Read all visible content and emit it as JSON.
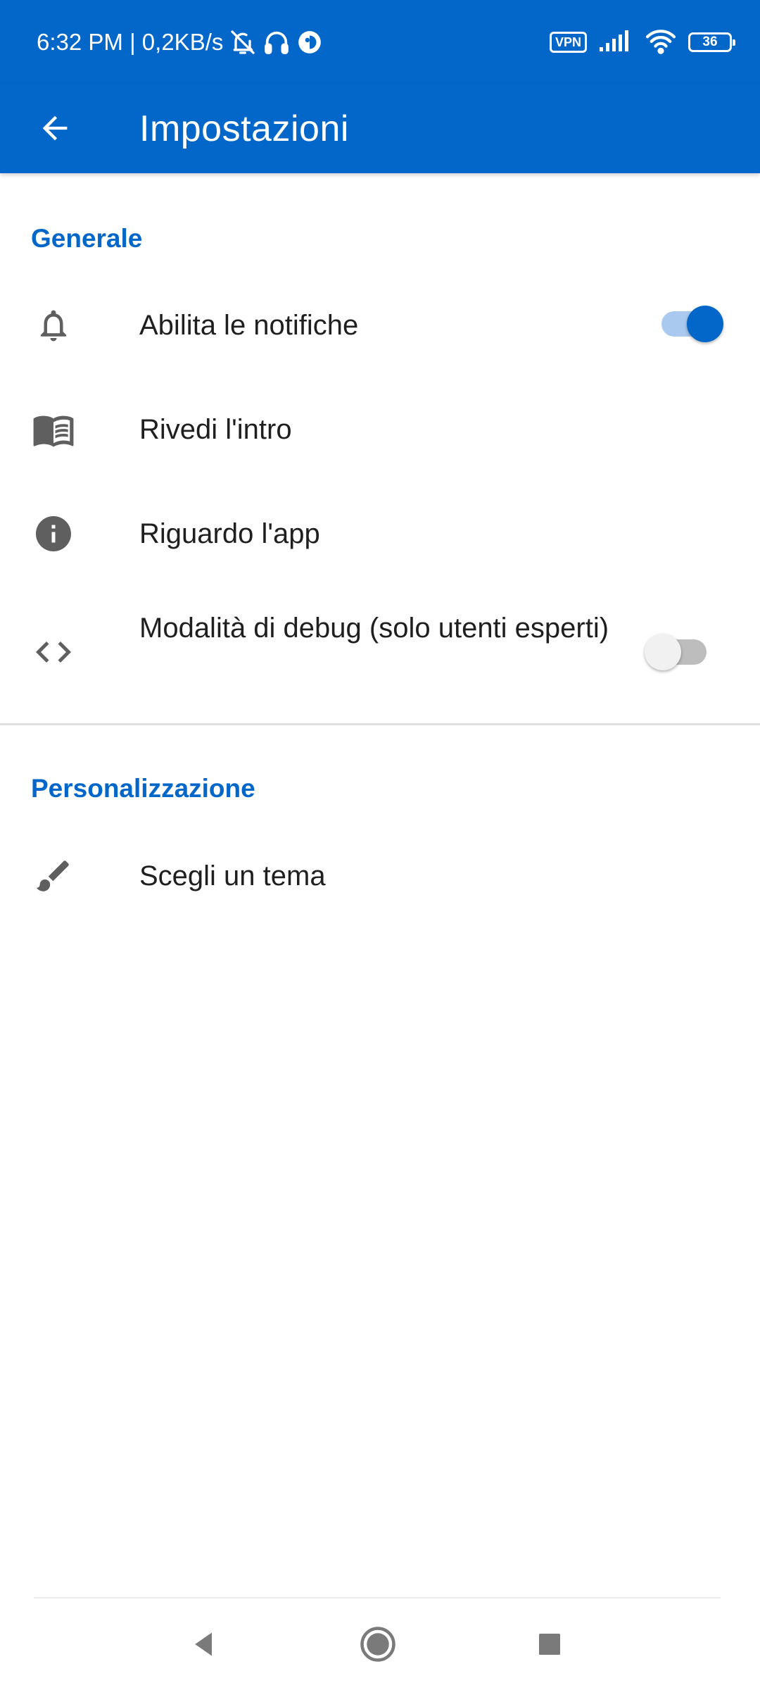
{
  "status_bar": {
    "time": "6:32 PM | 0,2KB/s",
    "vpn_label": "VPN",
    "battery_level": "36",
    "icons": [
      "bell-off-icon",
      "headphones-icon",
      "app-notification-icon",
      "signal-icon",
      "wifi-icon",
      "battery-icon"
    ]
  },
  "app_bar": {
    "title": "Impostazioni",
    "back_icon": "arrow-back-icon"
  },
  "sections": [
    {
      "header": "Generale",
      "items": [
        {
          "label": "Abilita le notifiche",
          "icon": "bell-icon",
          "toggle": true
        },
        {
          "label": "Rivedi l'intro",
          "icon": "book-icon"
        },
        {
          "label": "Riguardo l'app",
          "icon": "info-icon"
        },
        {
          "label": "Modalità di debug (solo utenti esperti)",
          "icon": "code-icon",
          "toggle": false
        }
      ]
    },
    {
      "header": "Personalizzazione",
      "items": [
        {
          "label": "Scegli un tema",
          "icon": "brush-icon"
        }
      ]
    }
  ],
  "nav_bar": {
    "icons": [
      "back-triangle-icon",
      "home-circle-icon",
      "recents-square-icon"
    ]
  },
  "colors": {
    "primary": "#0366c9",
    "toggle_track_on": "#a9c9ee",
    "icon_gray": "#5f5f5f",
    "text": "#1f1f1f"
  }
}
